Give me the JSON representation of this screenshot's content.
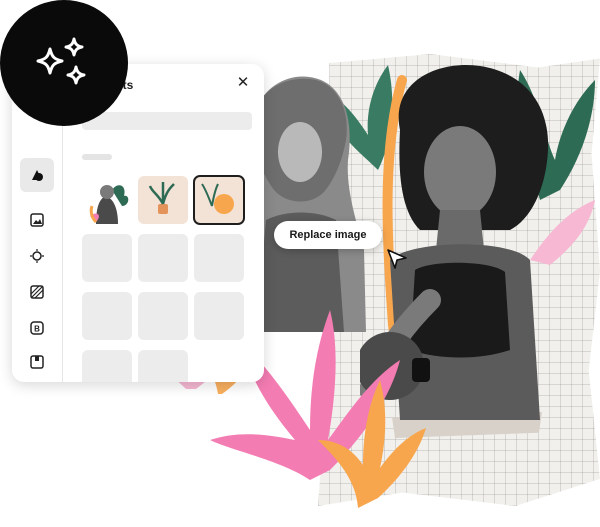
{
  "panel": {
    "title_partial": "ets",
    "close_symbol": "✕",
    "rail_icons": [
      "shapes-icon",
      "image-icon",
      "sun-icon",
      "pattern-icon",
      "badge-icon",
      "frame-icon"
    ]
  },
  "canvas": {
    "replace_label": "Replace image"
  },
  "colors": {
    "logo_bg": "#0a0a0a",
    "pink": "#f37cb3",
    "light_pink": "#f6b8d3",
    "orange": "#f8a64d",
    "green": "#2e6b55",
    "paper": "#f2f0ec"
  }
}
